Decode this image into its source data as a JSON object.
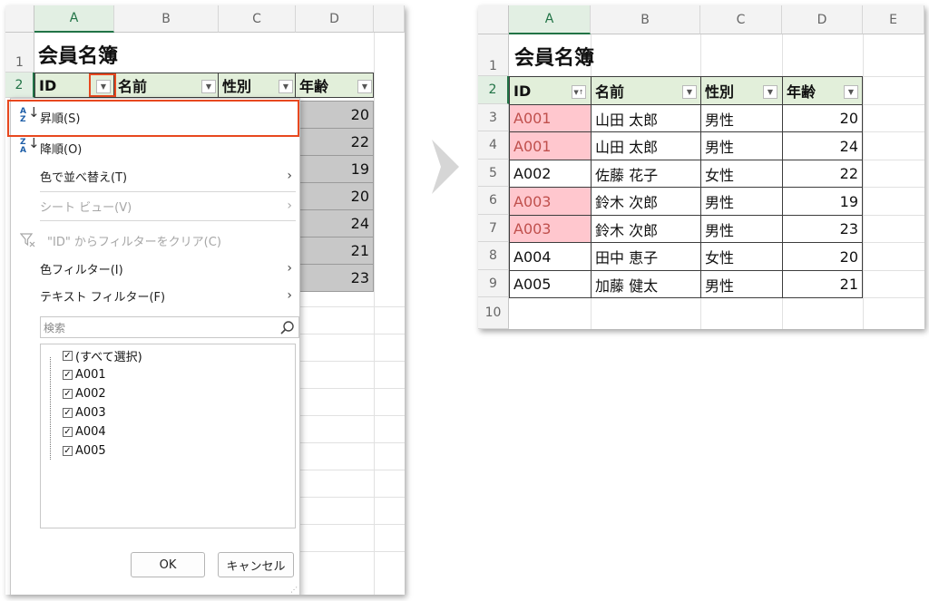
{
  "left": {
    "col_headers": [
      "A",
      "B",
      "C",
      "D"
    ],
    "row_headers": [
      "1",
      "2"
    ],
    "title": "会員名簿",
    "headers": [
      "ID",
      "名前",
      "性別",
      "年齢"
    ],
    "ages_visible": [
      "20",
      "22",
      "19",
      "20",
      "24",
      "21",
      "23"
    ],
    "menu": {
      "sort_asc": "昇順(S)",
      "sort_desc": "降順(O)",
      "sort_by_color": "色で並べ替え(T)",
      "sheet_view": "シート ビュー(V)",
      "clear_filter": "\"ID\" からフィルターをクリア(C)",
      "color_filter": "色フィルター(I)",
      "text_filter": "テキスト フィルター(F)",
      "search_placeholder": "検索",
      "items": [
        "(すべて選択)",
        "A001",
        "A002",
        "A003",
        "A004",
        "A005"
      ],
      "ok": "OK",
      "cancel": "キャンセル"
    }
  },
  "right": {
    "col_headers": [
      "A",
      "B",
      "C",
      "D",
      "E"
    ],
    "row_headers": [
      "1",
      "2",
      "3",
      "4",
      "5",
      "6",
      "7",
      "8",
      "9",
      "10"
    ],
    "title": "会員名簿",
    "headers": [
      "ID",
      "名前",
      "性別",
      "年齢"
    ],
    "rows": [
      {
        "id": "A001",
        "name": "山田 太郎",
        "gender": "男性",
        "age": "20",
        "dup": true
      },
      {
        "id": "A001",
        "name": "山田 太郎",
        "gender": "男性",
        "age": "24",
        "dup": true
      },
      {
        "id": "A002",
        "name": "佐藤 花子",
        "gender": "女性",
        "age": "22",
        "dup": false
      },
      {
        "id": "A003",
        "name": "鈴木 次郎",
        "gender": "男性",
        "age": "19",
        "dup": true
      },
      {
        "id": "A003",
        "name": "鈴木 次郎",
        "gender": "男性",
        "age": "23",
        "dup": true
      },
      {
        "id": "A004",
        "name": "田中 恵子",
        "gender": "女性",
        "age": "20",
        "dup": false
      },
      {
        "id": "A005",
        "name": "加藤 健太",
        "gender": "男性",
        "age": "21",
        "dup": false
      }
    ]
  },
  "colors": {
    "accent": "#217346",
    "highlight": "#e8481f",
    "duplicate_fill": "#ffc7ce",
    "duplicate_text": "#c0504d",
    "header_fill": "#e2efda"
  },
  "icons": [
    "sort-ascending-icon",
    "sort-descending-icon",
    "clear-filter-icon",
    "search-icon",
    "filter-dropdown-icon",
    "chevron-right-icon",
    "checkbox-icon"
  ]
}
